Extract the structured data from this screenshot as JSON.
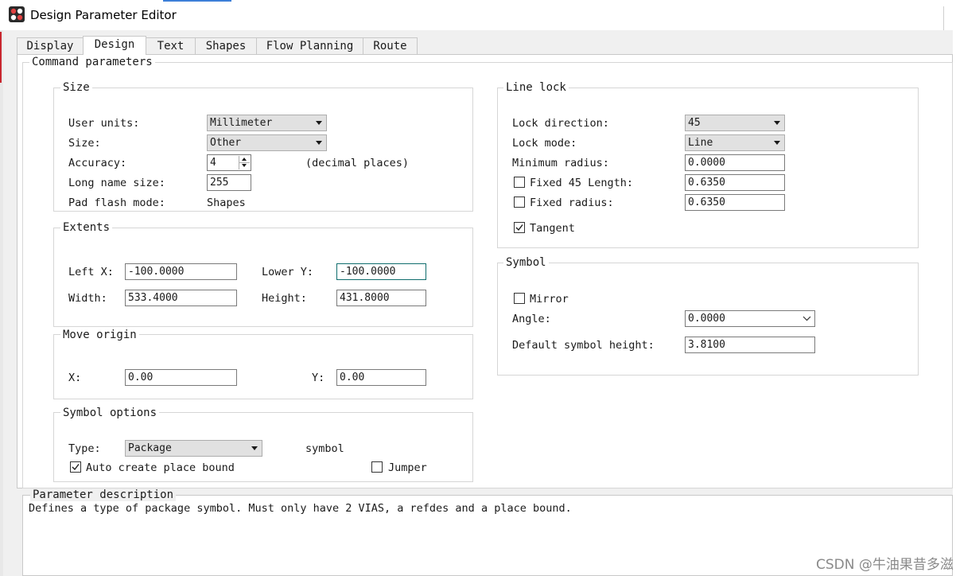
{
  "window": {
    "title": "Design Parameter Editor",
    "icon": "app-icon"
  },
  "tabs": [
    {
      "label": "Display",
      "active": false
    },
    {
      "label": "Design",
      "active": true
    },
    {
      "label": "Text",
      "active": false
    },
    {
      "label": "Shapes",
      "active": false
    },
    {
      "label": "Flow Planning",
      "active": false
    },
    {
      "label": "Route",
      "active": false
    }
  ],
  "command_params": {
    "title": "Command parameters"
  },
  "size": {
    "title": "Size",
    "user_units_label": "User units:",
    "user_units_value": "Millimeter",
    "size_label": "Size:",
    "size_value": "Other",
    "accuracy_label": "Accuracy:",
    "accuracy_value": "4",
    "accuracy_suffix": "(decimal places)",
    "long_name_label": "Long name size:",
    "long_name_value": "255",
    "pad_flash_label": "Pad flash mode:",
    "pad_flash_value": "Shapes"
  },
  "extents": {
    "title": "Extents",
    "left_x_label": "Left X:",
    "left_x_value": "-100.0000",
    "lower_y_label": "Lower Y:",
    "lower_y_value": "-100.0000",
    "width_label": "Width:",
    "width_value": "533.4000",
    "height_label": "Height:",
    "height_value": "431.8000"
  },
  "move_origin": {
    "title": "Move origin",
    "x_label": "X:",
    "x_value": "0.00",
    "y_label": "Y:",
    "y_value": "0.00"
  },
  "symbol_options": {
    "title": "Symbol options",
    "type_label": "Type:",
    "type_value": "Package",
    "type_suffix": "symbol",
    "auto_create_label": "Auto create place bound",
    "auto_create_checked": true,
    "jumper_label": "Jumper",
    "jumper_checked": false
  },
  "line_lock": {
    "title": "Line lock",
    "lock_direction_label": "Lock direction:",
    "lock_direction_value": "45",
    "lock_mode_label": "Lock mode:",
    "lock_mode_value": "Line",
    "min_radius_label": "Minimum radius:",
    "min_radius_value": "0.0000",
    "fixed45_label": "Fixed 45 Length:",
    "fixed45_value": "0.6350",
    "fixed45_checked": false,
    "fixed_radius_label": "Fixed radius:",
    "fixed_radius_value": "0.6350",
    "fixed_radius_checked": false,
    "tangent_label": "Tangent",
    "tangent_checked": true
  },
  "symbol": {
    "title": "Symbol",
    "mirror_label": "Mirror",
    "mirror_checked": false,
    "angle_label": "Angle:",
    "angle_value": "0.0000",
    "default_height_label": "Default symbol height:",
    "default_height_value": "3.8100"
  },
  "parameter_description": {
    "title": "Parameter description",
    "text": "Defines a type of package symbol.  Must only have 2 VIAS, a refdes and a place bound."
  },
  "watermark": "CSDN @牛油果昔多滋",
  "colors": {
    "focus_border": "#0f6d6d",
    "panel_bg": "#ffffff",
    "dialog_bg": "#f0f0f0",
    "title_accent": "#3c7fd8"
  }
}
